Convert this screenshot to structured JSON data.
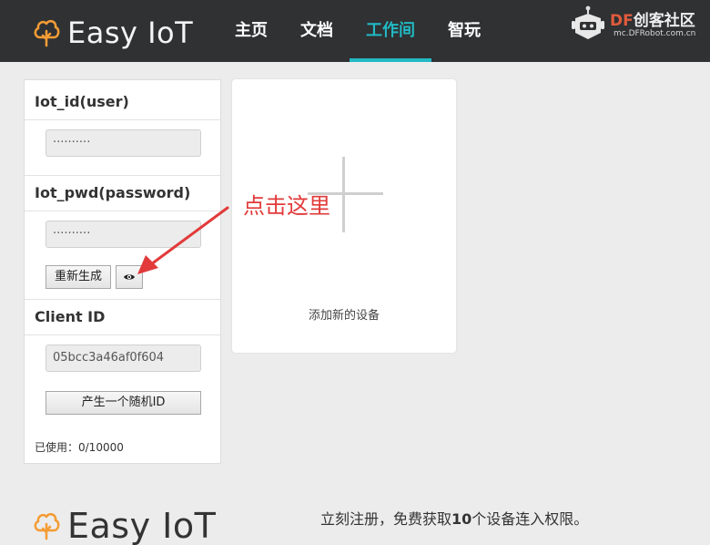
{
  "header": {
    "logo_text": "Easy IoT",
    "nav": [
      "主页",
      "文档",
      "工作间",
      "智玩"
    ],
    "active_nav": "工作间",
    "brand": {
      "df": "DF",
      "cn": "创客社区",
      "url": "mc.DFRobot.com.cn"
    }
  },
  "credentials": {
    "user_title": "Iot_id(user)",
    "user_value": "··········",
    "pwd_title": "Iot_pwd(password)",
    "pwd_value": "··········",
    "regen_label": "重新生成",
    "client_title": "Client ID",
    "client_value": "05bcc3a46af0f604",
    "random_id_label": "产生一个随机ID",
    "usage": "已使用：0/10000"
  },
  "device_card": {
    "label": "添加新的设备"
  },
  "annotation": {
    "text": "点击这里"
  },
  "footer": {
    "logo_text": "Easy IoT",
    "text_before": "立刻注册，免费获取",
    "count": "10",
    "text_after": "个设备连入权限。"
  },
  "colors": {
    "header_bg": "#2f3133",
    "accent": "#22b9c4",
    "logo_orange": "#f39c35",
    "annotation_red": "#e23a3a"
  }
}
